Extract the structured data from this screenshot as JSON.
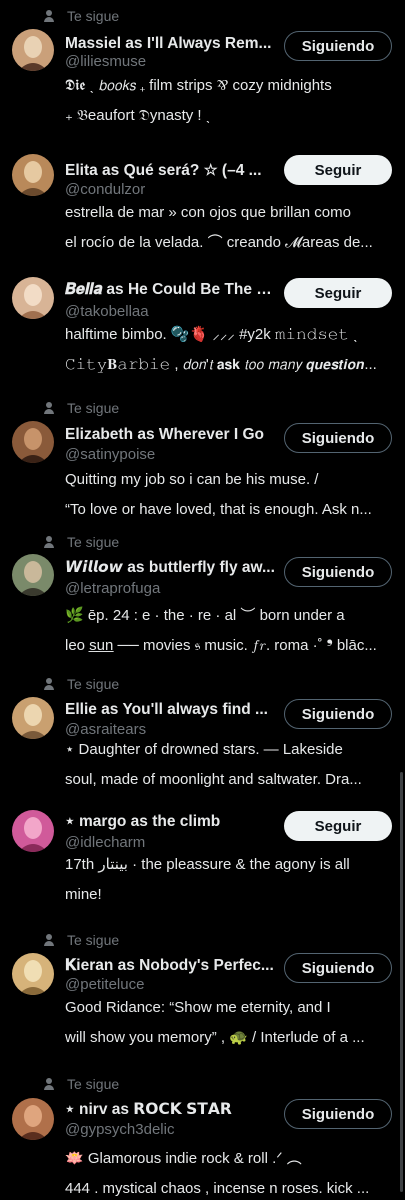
{
  "follows_you_label": "Te sigue",
  "users": [
    {
      "follows_you": true,
      "name": "Massiel as I'll Always Rem...",
      "handle": "@liliesmuse",
      "button": "Siguiendo",
      "bio": [
        "𝕯𝖎𝖊 ˎ      𝘣𝘰𝘰𝘬𝘴  ₊  film strips  ⅋  cozy midnights",
        "₊  𝔅eaufort 𝔇ynasty ! ˎ"
      ],
      "avatar_colors": [
        "#caa07a",
        "#5a3a2a",
        "#e9d2b4"
      ]
    },
    {
      "follows_you": false,
      "name": "Elita as Qué será? ☆ (–4 ...",
      "handle": "@condulzor",
      "button": "Seguir",
      "bio": [
        "estrella de mar » con ojos que brillan como",
        "el rocío de la velada. ⌒  creando 𝓜areas de..."
      ],
      "avatar_colors": [
        "#b9895a",
        "#6b4a2d",
        "#e6c9a1"
      ]
    },
    {
      "follows_you": false,
      "name": "𝑩𝒆𝒍𝒍𝒂 as He Could Be The One",
      "handle": "@takobellaa",
      "button": "Seguir",
      "bio": [
        "halftime bimbo. 🫧🫀 ⸝⸝⸝ #y2k 𝚖𝚒𝚗𝚍𝚜𝚎𝚝 ˎ",
        "𝙲𝚒𝚝𝚢𝐁𝚊𝚛𝚋𝚒𝚎 ,  𝘥𝘰𝘯'𝘵 𝗮𝘀𝗸 𝘵𝘰𝘰 𝘮𝘢𝘯𝘺 𝙦𝙪𝙚𝙨𝙩𝙞𝙤𝙣..."
      ],
      "avatar_colors": [
        "#d8b496",
        "#a0704f",
        "#f2dcc6"
      ]
    },
    {
      "follows_you": true,
      "name": "Elizabeth as Wherever I Go",
      "handle": "@satinypoise",
      "button": "Siguiendo",
      "bio": [
        "Quitting my job so i can be his muse. /",
        "“To love or have loved, that is enough. Ask n..."
      ],
      "avatar_colors": [
        "#8a5a3a",
        "#3a2216",
        "#c7936a"
      ]
    },
    {
      "follows_you": true,
      "name": "𝙒𝙞𝙡𝙡𝙤𝙬 as buttlerfly fly aw...",
      "handle": "@letraprofuga",
      "button": "Siguiendo",
      "bio": [
        "  🌿  ēp. 24 :  e · the · re · al  ︶  born under a",
        "leo s̲u̲n̲ ── movies 𝔰 music. 𝑓𝑟. roma ·˚ ❜ blāc..."
      ],
      "avatar_colors": [
        "#7a8a6a",
        "#3a3a2e",
        "#c9b89a"
      ]
    },
    {
      "follows_you": true,
      "name": "Ellie as You'll always find ...",
      "handle": "@asraitears",
      "button": "Siguiendo",
      "bio": [
        "      ⋆  Daughter of drowned stars. — Lakeside",
        "soul, made of moonlight and saltwater. Dra..."
      ],
      "avatar_colors": [
        "#c9a070",
        "#7a5a3a",
        "#ecd6b0"
      ]
    },
    {
      "follows_you": false,
      "name": "⋆ margo as the climb",
      "handle": "@idlecharm",
      "button": "Seguir",
      "bio": [
        "17th بينتار   ·    the pleassure & the agony is all",
        "mine!"
      ],
      "avatar_colors": [
        "#d05a9a",
        "#8a2a5a",
        "#f2a6c9"
      ]
    },
    {
      "follows_you": true,
      "name": "𝐊ieran as Nobody's Perfec...",
      "handle": "@petiteluce",
      "button": "Siguiendo",
      "bio": [
        "Good Ridance: “Show me eternity, and I",
        "will show you memory” , 🐢 / Interlude of a ..."
      ],
      "avatar_colors": [
        "#d6b37a",
        "#8a6a3a",
        "#f0deb4"
      ]
    },
    {
      "follows_you": true,
      "name": "⋆ nirv as 𝗥𝗢𝗖𝗞 𝗦𝗧𝗔𝗥",
      "handle": "@gypsych3delic",
      "button": "Siguiendo",
      "bio": [
        "    🪷    Glamorous indie rock & roll .ᐟ  ︵",
        "444 . mystical chaos , incense n roses. kick ..."
      ],
      "avatar_colors": [
        "#b0704a",
        "#5a2e1e",
        "#dfa57e"
      ]
    }
  ]
}
